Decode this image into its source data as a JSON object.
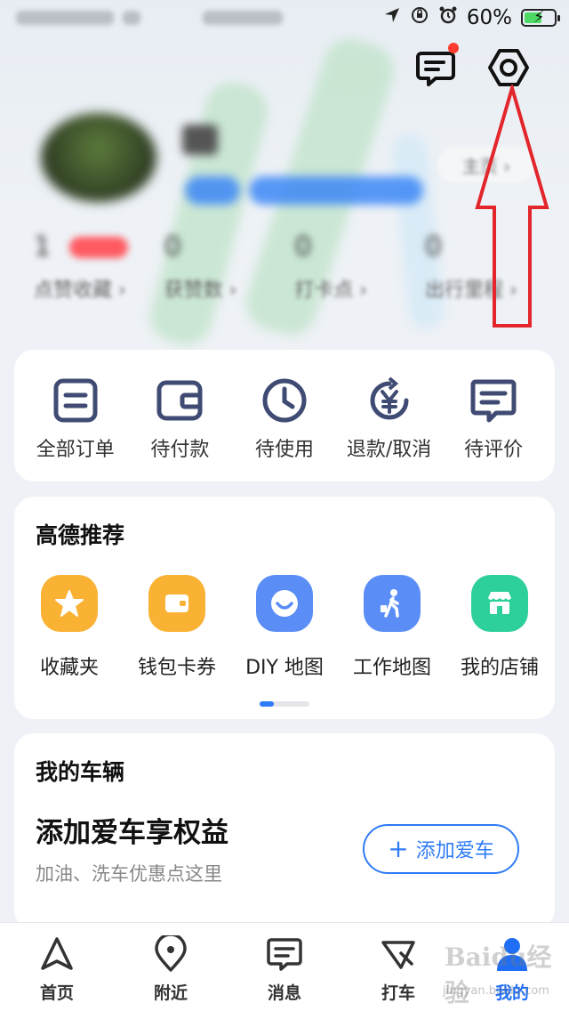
{
  "status_bar": {
    "battery": "60%",
    "battery_level": 0.6
  },
  "header": {
    "homepage_label": "主页 ›",
    "stats": [
      {
        "value": "1",
        "label": "点赞收藏 ›"
      },
      {
        "value": "0",
        "label": "获赞数 ›"
      },
      {
        "value": "0",
        "label": "打卡点 ›"
      },
      {
        "value": "0",
        "label": "出行里程 ›"
      }
    ]
  },
  "orders": {
    "items": [
      {
        "label": "全部订单",
        "icon": "list-doc-icon"
      },
      {
        "label": "待付款",
        "icon": "wallet-icon"
      },
      {
        "label": "待使用",
        "icon": "clock-icon"
      },
      {
        "label": "退款/取消",
        "icon": "yen-refund-icon"
      },
      {
        "label": "待评价",
        "icon": "comment-icon"
      }
    ]
  },
  "recommend": {
    "title": "高德推荐",
    "items": [
      {
        "label": "收藏夹",
        "icon": "star-icon",
        "color": "#f9b233"
      },
      {
        "label": "钱包卡券",
        "icon": "wallet-icon",
        "color": "#f9b233"
      },
      {
        "label": "DIY 地图",
        "icon": "smile-map-icon",
        "color": "#5b8df6"
      },
      {
        "label": "工作地图",
        "icon": "walker-icon",
        "color": "#5b8df6"
      },
      {
        "label": "我的店铺",
        "icon": "store-icon",
        "color": "#2dcf9a"
      }
    ]
  },
  "vehicle": {
    "title": "我的车辆",
    "headline": "添加爱车享权益",
    "subtitle": "加油、洗车优惠点这里",
    "button": "添加爱车"
  },
  "tabbar": {
    "items": [
      {
        "label": "首页",
        "icon": "navigate-icon"
      },
      {
        "label": "附近",
        "icon": "location-pin-icon"
      },
      {
        "label": "消息",
        "icon": "message-icon"
      },
      {
        "label": "打车",
        "icon": "taxi-icon"
      },
      {
        "label": "我的",
        "icon": "user-icon"
      }
    ],
    "active": "我的"
  },
  "colors": {
    "accent": "#2f7cf6",
    "annotation": "#e3262b"
  },
  "watermark": {
    "text": "Baidu经验",
    "sub": "jingyan.baidu.com"
  }
}
